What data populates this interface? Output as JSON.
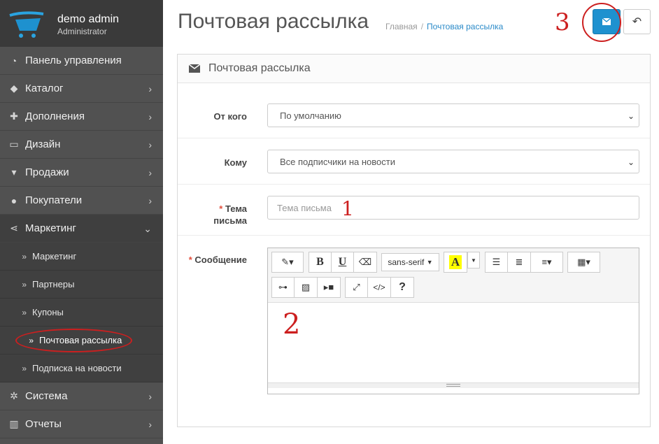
{
  "user": {
    "name": "demo admin",
    "role": "Administrator"
  },
  "menu": [
    {
      "label": "Панель управления",
      "icon": "dashboard-icon",
      "chevron": false
    },
    {
      "label": "Каталог",
      "icon": "tag-icon",
      "chevron": true
    },
    {
      "label": "Дополнения",
      "icon": "puzzle-icon",
      "chevron": true
    },
    {
      "label": "Дизайн",
      "icon": "monitor-icon",
      "chevron": true
    },
    {
      "label": "Продажи",
      "icon": "cart-icon",
      "chevron": true
    },
    {
      "label": "Покупатели",
      "icon": "user-icon",
      "chevron": true
    },
    {
      "label": "Маркетинг",
      "icon": "share-icon",
      "chevron": "open"
    }
  ],
  "submenu": [
    {
      "label": "Маркетинг"
    },
    {
      "label": "Партнеры"
    },
    {
      "label": "Купоны"
    },
    {
      "label": "Почтовая рассылка",
      "active": true
    },
    {
      "label": "Подписка на новости"
    }
  ],
  "menu_bottom": [
    {
      "label": "Система",
      "icon": "gear-icon"
    },
    {
      "label": "Отчеты",
      "icon": "bar-chart-icon"
    }
  ],
  "header": {
    "title": "Почтовая рассылка",
    "breadcrumb": [
      "Главная",
      "Почтовая рассылка"
    ],
    "send_title": "Отправить",
    "annotation": "3"
  },
  "panel": {
    "title": "Почтовая рассылка"
  },
  "form": {
    "from_label": "От кого",
    "from_value": "По умолчанию",
    "to_label": "Кому",
    "to_value": "Все подписчики на новости",
    "subject_label_1": "Тема",
    "subject_label_2": "письма",
    "subject_placeholder": "Тема письма",
    "subject_annotation": "1",
    "message_label": "Сообщение",
    "message_annotation": "2",
    "required_mark": "*"
  },
  "editor": {
    "font_name": "sans-serif",
    "color_letter": "A",
    "bold": "B",
    "underline": "U",
    "help": "?",
    "code": "</>"
  },
  "colors": {
    "sidebar": "#515151",
    "primary": "#1e91cf",
    "annotation": "#cc1f1f",
    "required": "#e3503e"
  }
}
